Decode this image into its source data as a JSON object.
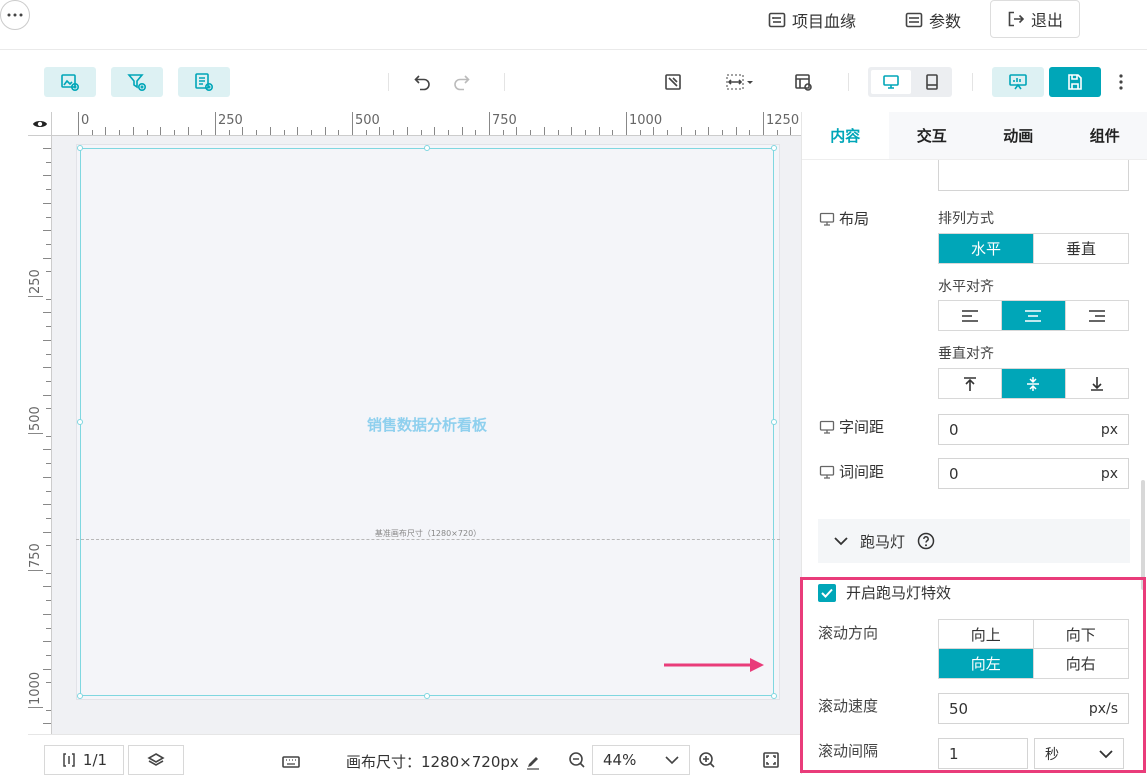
{
  "topbar": {
    "lineage_label": "项目血缘",
    "params_label": "参数",
    "exit_label": "退出"
  },
  "canvas": {
    "ruler_h_labels": [
      "0",
      "250",
      "500",
      "750",
      "1000",
      "1250"
    ],
    "ruler_v_labels": [
      "250",
      "500",
      "750",
      "1000"
    ],
    "board_title": "销售数据分析看板",
    "baseline_label": "基准画布尺寸（1280×720）"
  },
  "bottombar": {
    "page_counter": "1/1",
    "canvas_size_label": "画布尺寸：1280×720px",
    "zoom_value": "44%"
  },
  "panel": {
    "tabs": [
      {
        "label": "内容",
        "active": true
      },
      {
        "label": "交互",
        "active": false
      },
      {
        "label": "动画",
        "active": false
      },
      {
        "label": "组件",
        "active": false
      }
    ],
    "layout_label": "布局",
    "arrange_label": "排列方式",
    "arrange_options": [
      "水平",
      "垂直"
    ],
    "arrange_selected": "水平",
    "halign_label": "水平对齐",
    "halign_selected": "center",
    "valign_label": "垂直对齐",
    "valign_selected": "middle",
    "letter_spacing_label": "字间距",
    "letter_spacing_value": "0",
    "letter_spacing_unit": "px",
    "word_spacing_label": "词间距",
    "word_spacing_value": "0",
    "word_spacing_unit": "px",
    "marquee_section_label": "跑马灯",
    "marquee_enable_label": "开启跑马灯特效",
    "marquee_enabled": true,
    "direction_label": "滚动方向",
    "direction_options": [
      "向上",
      "向下",
      "向左",
      "向右"
    ],
    "direction_selected": "向左",
    "speed_label": "滚动速度",
    "speed_value": "50",
    "speed_unit": "px/s",
    "interval_label": "滚动间隔",
    "interval_value": "1",
    "interval_unit": "秒"
  },
  "colors": {
    "accent": "#00a6b8",
    "highlight": "#e93c7a",
    "board_title": "#8fd0ee"
  }
}
